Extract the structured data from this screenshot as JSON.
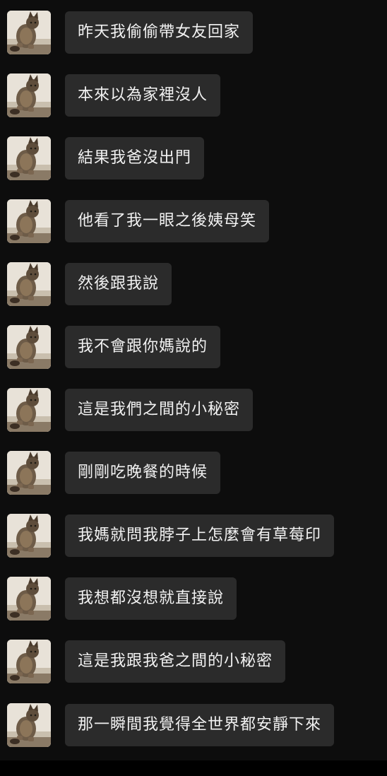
{
  "messages": [
    {
      "text": "昨天我偷偷帶女友回家",
      "avatar": "cat-avatar"
    },
    {
      "text": "本來以為家裡沒人",
      "avatar": "cat-avatar"
    },
    {
      "text": "結果我爸沒出門",
      "avatar": "cat-avatar"
    },
    {
      "text": "他看了我一眼之後姨母笑",
      "avatar": "cat-avatar"
    },
    {
      "text": "然後跟我說",
      "avatar": "cat-avatar"
    },
    {
      "text": "我不會跟你媽說的",
      "avatar": "cat-avatar"
    },
    {
      "text": "這是我們之間的小秘密",
      "avatar": "cat-avatar"
    },
    {
      "text": "剛剛吃晚餐的時候",
      "avatar": "cat-avatar"
    },
    {
      "text": "我媽就問我脖子上怎麼會有草莓印",
      "avatar": "cat-avatar"
    },
    {
      "text": "我想都沒想就直接說",
      "avatar": "cat-avatar"
    },
    {
      "text": "這是我跟我爸之間的小秘密",
      "avatar": "cat-avatar"
    },
    {
      "text": "那一瞬間我覺得全世界都安靜下來",
      "avatar": "cat-avatar"
    }
  ],
  "colors": {
    "background": "#0d0d0d",
    "bubble": "#2b2b2b",
    "text": "#f2f2f2"
  }
}
